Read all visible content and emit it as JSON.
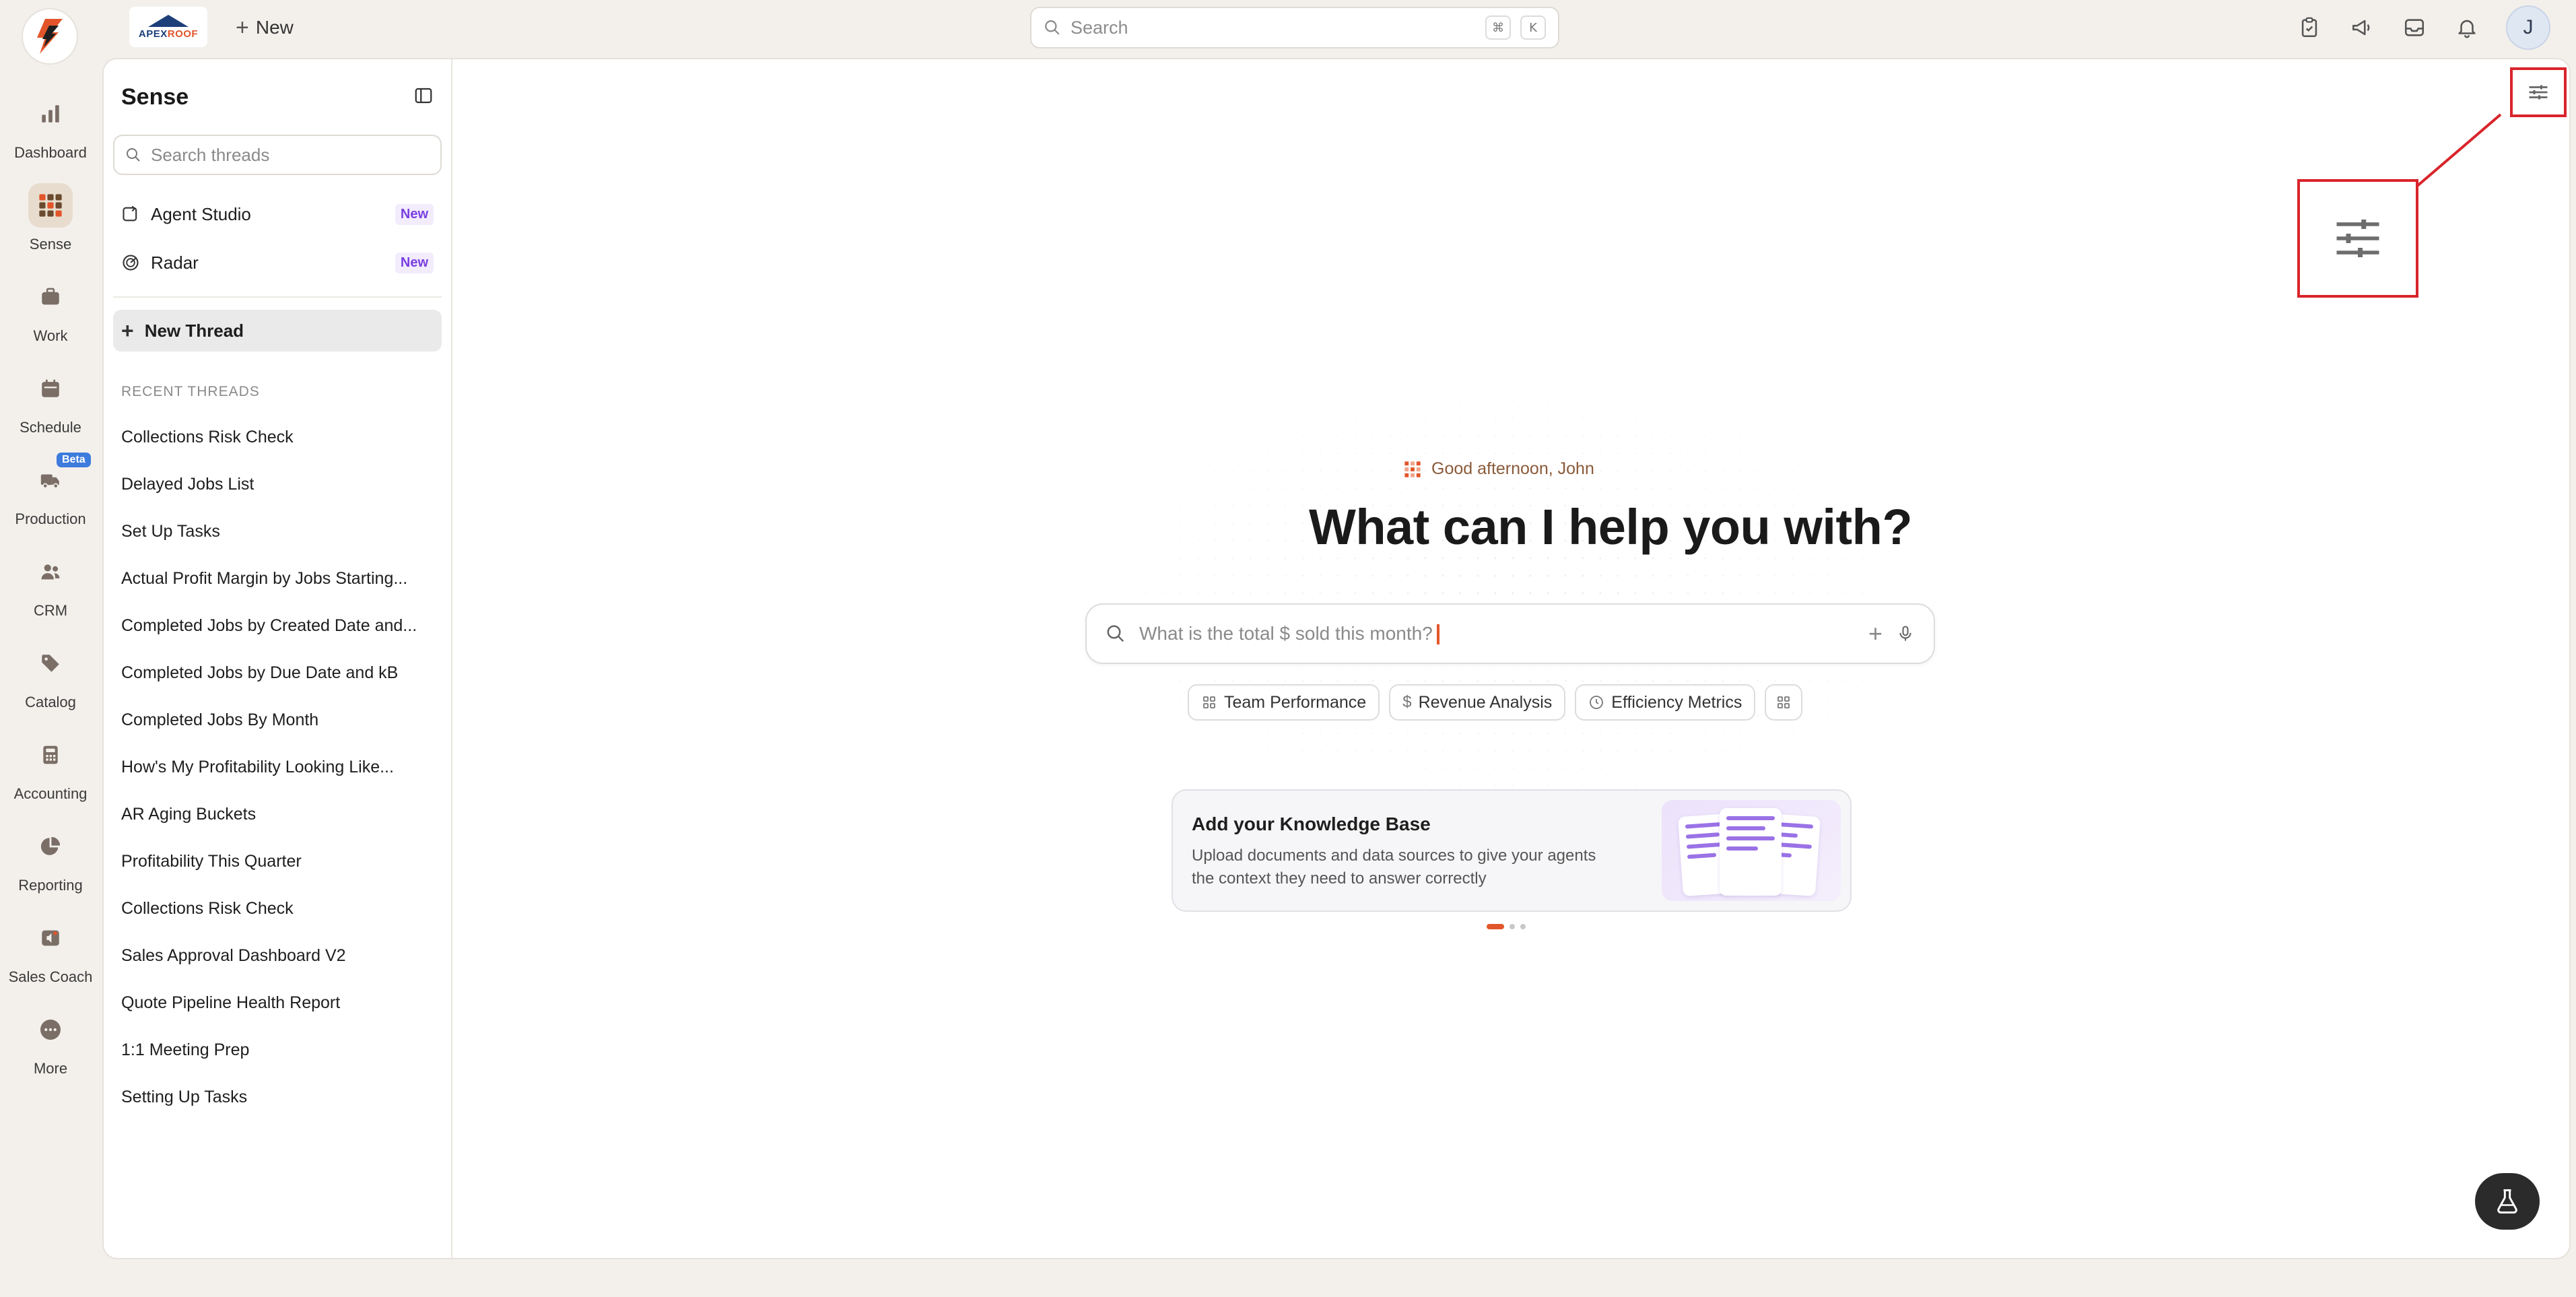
{
  "topbar": {
    "company_logo_text_1": "APEX",
    "company_logo_text_2": "ROOF",
    "new_label": "New",
    "search_placeholder": "Search",
    "shortcut_keys": [
      "⌘",
      "K"
    ],
    "avatar_initial": "J",
    "icons": [
      "clipboard-check-icon",
      "megaphone-icon",
      "inbox-icon",
      "bell-icon"
    ]
  },
  "nav": {
    "items": [
      {
        "label": "Dashboard",
        "icon": "bar-chart-icon",
        "active": false
      },
      {
        "label": "Sense",
        "icon": "grid-dots-icon",
        "active": true
      },
      {
        "label": "Work",
        "icon": "briefcase-icon",
        "active": false
      },
      {
        "label": "Schedule",
        "icon": "calendar-icon",
        "active": false
      },
      {
        "label": "Production",
        "icon": "truck-icon",
        "active": false,
        "badge": "Beta"
      },
      {
        "label": "CRM",
        "icon": "users-icon",
        "active": false
      },
      {
        "label": "Catalog",
        "icon": "tag-icon",
        "active": false
      },
      {
        "label": "Accounting",
        "icon": "calculator-icon",
        "active": false
      },
      {
        "label": "Reporting",
        "icon": "pie-chart-icon",
        "active": false
      },
      {
        "label": "Sales Coach",
        "icon": "coach-icon",
        "active": false
      },
      {
        "label": "More",
        "icon": "ellipsis-icon",
        "active": false
      }
    ]
  },
  "panel": {
    "title": "Sense",
    "search_placeholder": "Search threads",
    "features": [
      {
        "label": "Agent Studio",
        "badge": "New"
      },
      {
        "label": "Radar",
        "badge": "New"
      }
    ],
    "new_thread_label": "New Thread",
    "recent_label": "RECENT THREADS",
    "threads": [
      "Collections Risk Check",
      "Delayed Jobs List",
      "Set Up Tasks",
      "Actual Profit Margin by Jobs Starting...",
      "Completed Jobs by Created Date and...",
      "Completed Jobs by Due Date and kB",
      "Completed Jobs By Month",
      "How's My Profitability Looking Like...",
      "AR Aging Buckets",
      "Profitability This Quarter",
      "Collections Risk Check",
      "Sales Approval Dashboard V2",
      "Quote Pipeline Health Report",
      "1:1 Meeting Prep",
      "Setting Up Tasks"
    ]
  },
  "main": {
    "greeting": "Good afternoon, John",
    "headline": "What can I help you with?",
    "ask_placeholder": "What is the total $ sold this month?",
    "chips": [
      "Team Performance",
      "Revenue Analysis",
      "Efficiency Metrics"
    ],
    "kb_title": "Add your Knowledge Base",
    "kb_desc": "Upload documents and data sources to give your agents the context they need to answer correctly",
    "carousel_count": 3,
    "carousel_active": 1
  },
  "colors": {
    "accent": "#e2552a",
    "highlight": "#d9242b",
    "badge_purple": "#7a3fe0",
    "beta_blue": "#3d7bdc"
  }
}
